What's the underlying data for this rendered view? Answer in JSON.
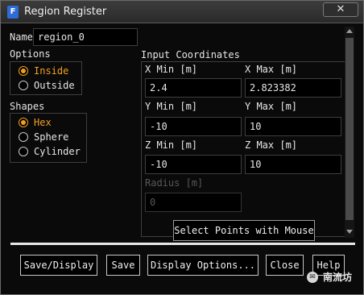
{
  "window": {
    "title": "Region Register",
    "app_icon": "F",
    "close_label": "✕"
  },
  "name": {
    "label": "Name",
    "value": "region_0"
  },
  "options": {
    "label": "Options",
    "items": [
      {
        "label": "Inside",
        "selected": true
      },
      {
        "label": "Outside",
        "selected": false
      }
    ]
  },
  "shapes": {
    "label": "Shapes",
    "items": [
      {
        "label": "Hex",
        "selected": true
      },
      {
        "label": "Sphere",
        "selected": false
      },
      {
        "label": "Cylinder",
        "selected": false
      }
    ]
  },
  "coords": {
    "label": "Input Coordinates",
    "x_min": {
      "label": "X Min [m]",
      "value": "2.4"
    },
    "x_max": {
      "label": "X Max [m]",
      "value": "2.823382"
    },
    "y_min": {
      "label": "Y Min [m]",
      "value": "-10"
    },
    "y_max": {
      "label": "Y Max [m]",
      "value": "10"
    },
    "z_min": {
      "label": "Z Min [m]",
      "value": "-10"
    },
    "z_max": {
      "label": "Z Max [m]",
      "value": "10"
    },
    "radius": {
      "label": "Radius [m]",
      "value": "0",
      "disabled": true
    },
    "select_points_label": "Select Points with Mouse"
  },
  "buttons": {
    "save_display": "Save/Display",
    "save": "Save",
    "display_options": "Display Options...",
    "close": "Close",
    "help": "Help"
  },
  "watermark": {
    "text": "南流坊"
  },
  "colors": {
    "accent": "#f0a020",
    "background": "#0a0a0a",
    "border": "#3e3e3e"
  }
}
